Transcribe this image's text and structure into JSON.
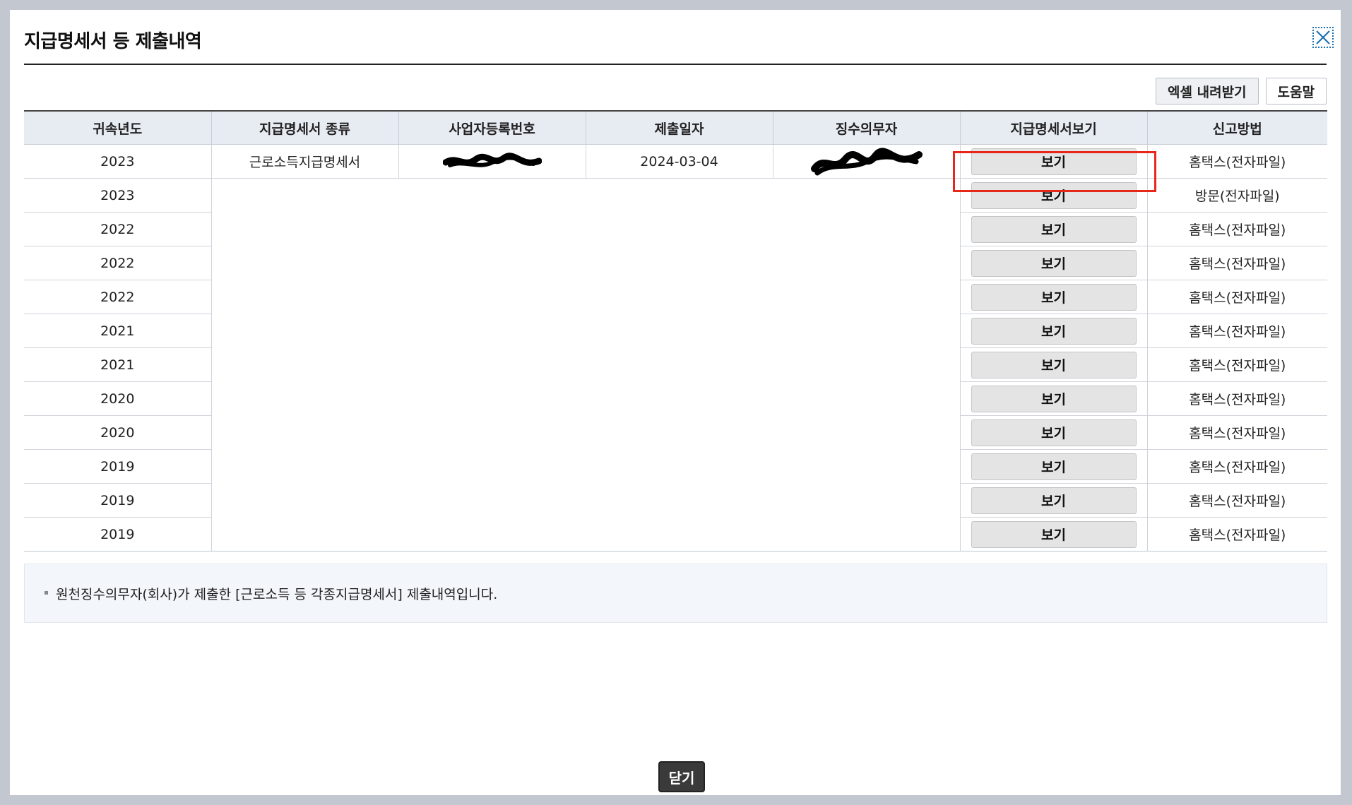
{
  "dialog": {
    "title": "지급명세서 등 제출내역",
    "close_icon": "close-x-icon",
    "excel_button": "엑셀 내려받기",
    "help_button": "도움말",
    "close_button": "닫기"
  },
  "table": {
    "headers": [
      "귀속년도",
      "지급명세서 종류",
      "사업자등록번호",
      "제출일자",
      "징수의무자",
      "지급명세서보기",
      "신고방법"
    ],
    "first_row": {
      "year": "2023",
      "type": "근로소득지급명세서",
      "submit_date": "2024-03-04",
      "view": "보기",
      "method": "홈택스(전자파일)"
    },
    "rows": [
      {
        "year": "2023",
        "view": "보기",
        "method": "방문(전자파일)"
      },
      {
        "year": "2022",
        "view": "보기",
        "method": "홈택스(전자파일)"
      },
      {
        "year": "2022",
        "view": "보기",
        "method": "홈택스(전자파일)"
      },
      {
        "year": "2022",
        "view": "보기",
        "method": "홈택스(전자파일)"
      },
      {
        "year": "2021",
        "view": "보기",
        "method": "홈택스(전자파일)"
      },
      {
        "year": "2021",
        "view": "보기",
        "method": "홈택스(전자파일)"
      },
      {
        "year": "2020",
        "view": "보기",
        "method": "홈택스(전자파일)"
      },
      {
        "year": "2020",
        "view": "보기",
        "method": "홈택스(전자파일)"
      },
      {
        "year": "2019",
        "view": "보기",
        "method": "홈택스(전자파일)"
      },
      {
        "year": "2019",
        "view": "보기",
        "method": "홈택스(전자파일)"
      },
      {
        "year": "2019",
        "view": "보기",
        "method": "홈택스(전자파일)"
      }
    ]
  },
  "info": {
    "text": "원천징수의무자(회사)가 제출한 [근로소득 등 각종지급명세서] 제출내역입니다."
  },
  "colors": {
    "header_bg": "#e7ebf2",
    "highlight": "#e8271b",
    "close_button_bg": "#3a3a3a"
  }
}
